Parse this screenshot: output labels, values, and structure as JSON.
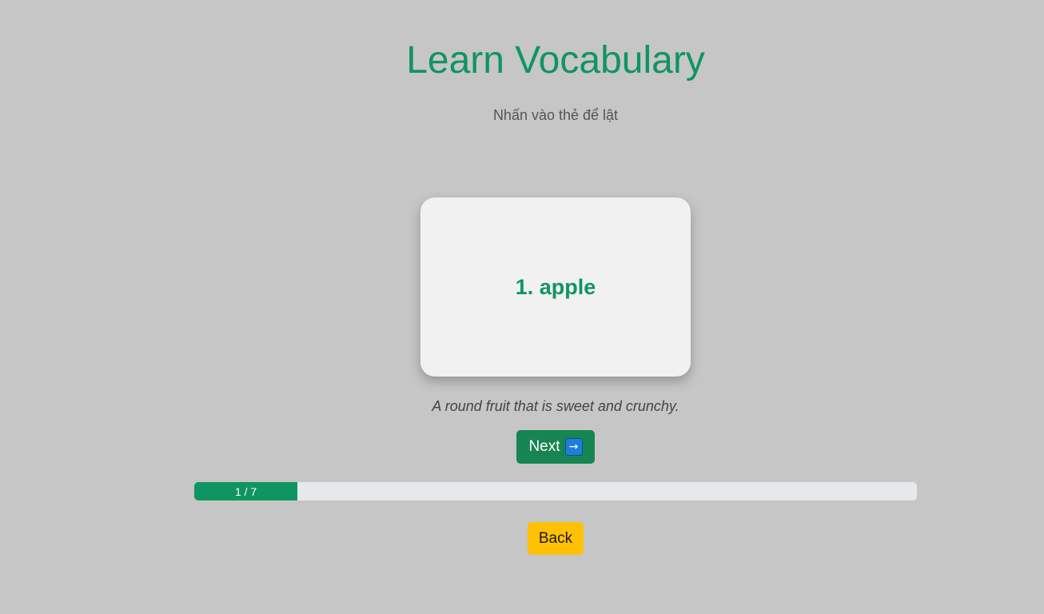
{
  "header": {
    "title": "Learn Vocabulary",
    "subtitle": "Nhấn vào thẻ để lật"
  },
  "card": {
    "word": "1. apple",
    "definition": "A round fruit that is sweet and crunchy."
  },
  "controls": {
    "next_label": "Next",
    "next_icon": "→",
    "back_label": "Back"
  },
  "progress": {
    "current": 1,
    "total": 7,
    "label": "1 / 7"
  },
  "colors": {
    "background": "#c6c6c6",
    "accent": "#0f9561",
    "next_button": "#178553",
    "back_button": "#ffc106",
    "progress_track": "#e6e9ec",
    "card": "#f1f1f1"
  }
}
